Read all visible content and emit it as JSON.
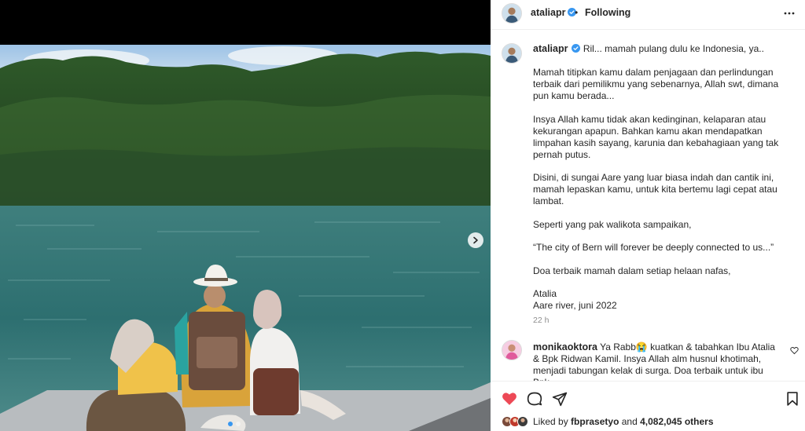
{
  "post": {
    "username": "ataliapr",
    "follow_state": "Following",
    "separator": "•"
  },
  "caption": {
    "lines": [
      "Ril... mamah pulang dulu ke Indonesia, ya..",
      "Mamah titipkan kamu dalam penjagaan dan perlindungan terbaik dari pemilikmu yang sebenarnya, Allah swt, dimana pun kamu berada...",
      "Insya Allah kamu tidak akan kedinginan, kelaparan atau kekurangan apapun. Bahkan kamu akan mendapatkan limpahan kasih sayang, karunia dan kebahagiaan yang tak pernah putus.",
      "Disini, di sungai Aare yang luar biasa indah dan cantik ini, mamah lepaskan kamu, untuk kita bertemu lagi cepat atau lambat.",
      "Seperti yang pak walikota sampaikan,",
      "“The city of Bern will forever be deeply connected to us...”",
      "Doa terbaik mamah dalam setiap helaan nafas,",
      "Atalia",
      "Aare river, juni 2022"
    ],
    "time": "22 h"
  },
  "comment": {
    "username": "monikaoktora",
    "text": "Ya Rabb😭 kuatkan & tabahkan Ibu Atalia & Bpk Ridwan Kamil. Insya Allah alm husnul khotimah, menjadi tabungan kelak di surga. Doa terbaik untuk ibu Bpk"
  },
  "likes": {
    "prefix": "Liked by",
    "user": "fbprasetyo",
    "conjunction": "and",
    "count": "4,082,045 others"
  },
  "icons": {
    "verified": "verified-badge-icon",
    "more": "more-options-icon",
    "next": "chevron-right-icon",
    "like": "heart-filled-icon",
    "comment": "comment-bubble-icon",
    "share": "paper-plane-icon",
    "save": "bookmark-icon",
    "comment_like": "heart-outline-icon"
  },
  "colors": {
    "accent_blue": "#3897f0",
    "like_red": "#ed4956",
    "text": "#262626",
    "muted": "#8e8e8e"
  },
  "carousel": {
    "slides": 2,
    "active_index": 0
  }
}
